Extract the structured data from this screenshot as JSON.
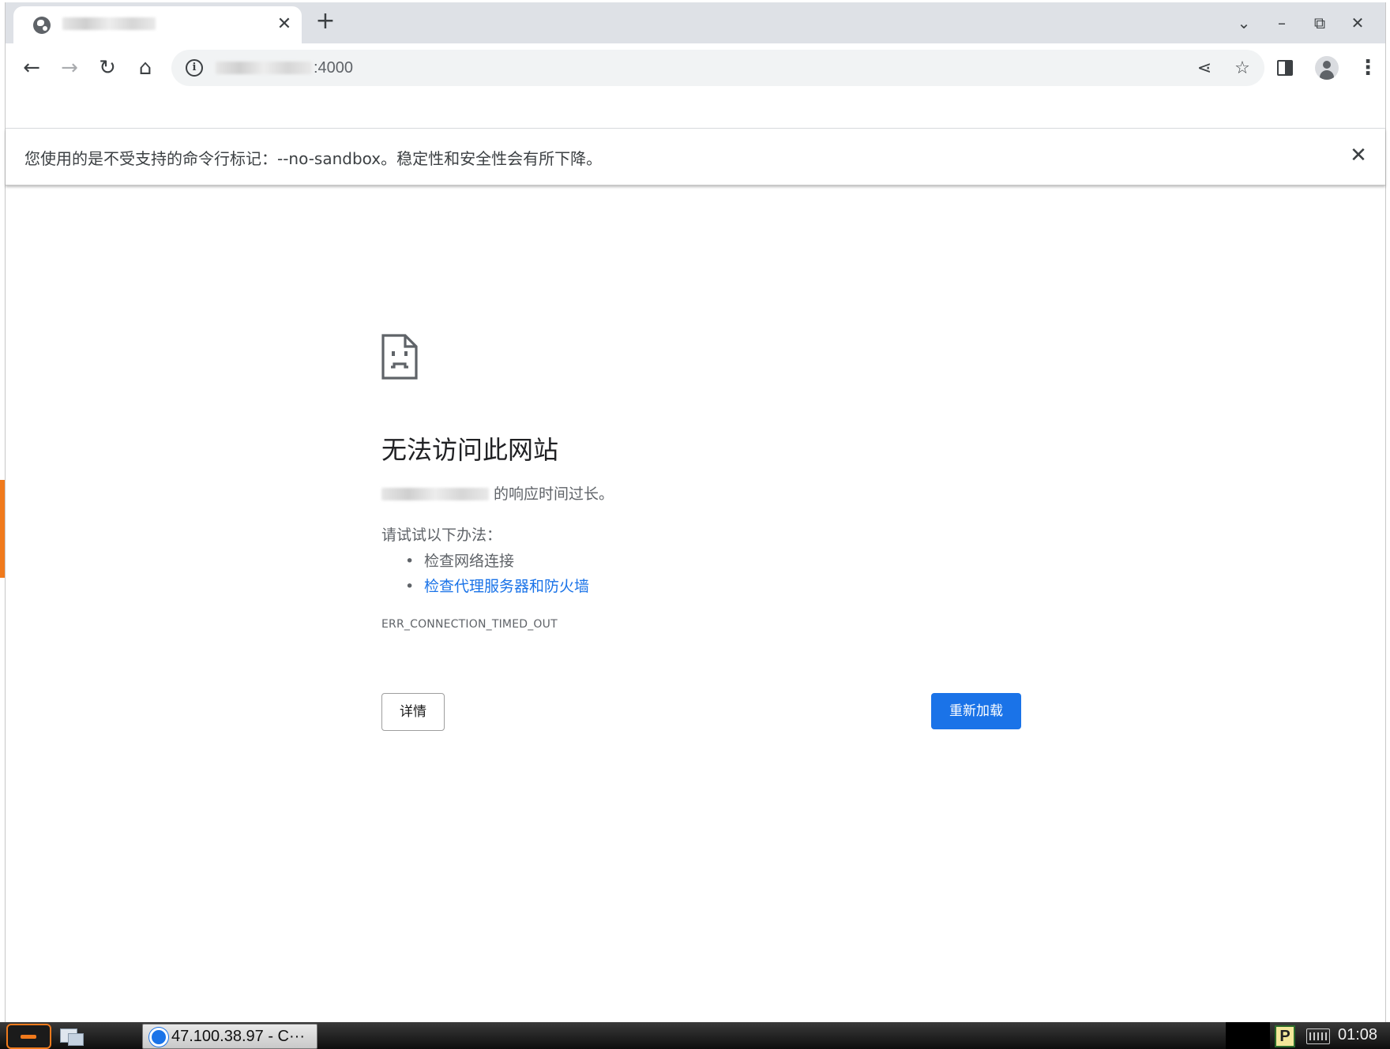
{
  "browser": {
    "tab": {
      "close_glyph": "✕",
      "icon": "globe-icon"
    },
    "new_tab_glyph": "+",
    "window_controls": {
      "tab_search_glyph": "⌄",
      "minimize_glyph": "–",
      "restore_glyph": "⧉",
      "close_glyph": "✕"
    },
    "toolbar": {
      "back_glyph": "←",
      "forward_glyph": "→",
      "reload_glyph": "↻",
      "home_glyph": "⌂",
      "url_port": ":4000",
      "info_glyph": "i",
      "share_glyph": "⋖",
      "bookmark_glyph": "☆",
      "menu_glyph": "⋮"
    },
    "infobar": {
      "message": "您使用的是不受支持的命令行标记：--no-sandbox。稳定性和安全性会有所下降。",
      "close_glyph": "✕"
    }
  },
  "error_page": {
    "title": "无法访问此网站",
    "description_suffix": " 的响应时间过长。",
    "try_label": "请试试以下办法：",
    "suggestions": [
      {
        "text": "检查网络连接"
      },
      {
        "text": "检查代理服务器和防火墙"
      }
    ],
    "error_code": "ERR_CONNECTION_TIMED_OUT",
    "details_label": "详情",
    "reload_label": "重新加载"
  },
  "taskbar": {
    "task_label": "47.100.38.97 - C···",
    "tray_p_label": "P",
    "clock": "01:08"
  },
  "colors": {
    "accent_blue": "#1a73e8",
    "link_blue": "#1a73e8",
    "start_orange": "#f07a1c",
    "tabstrip_gray": "#dee1e6",
    "omnibox_gray": "#f1f3f4"
  }
}
